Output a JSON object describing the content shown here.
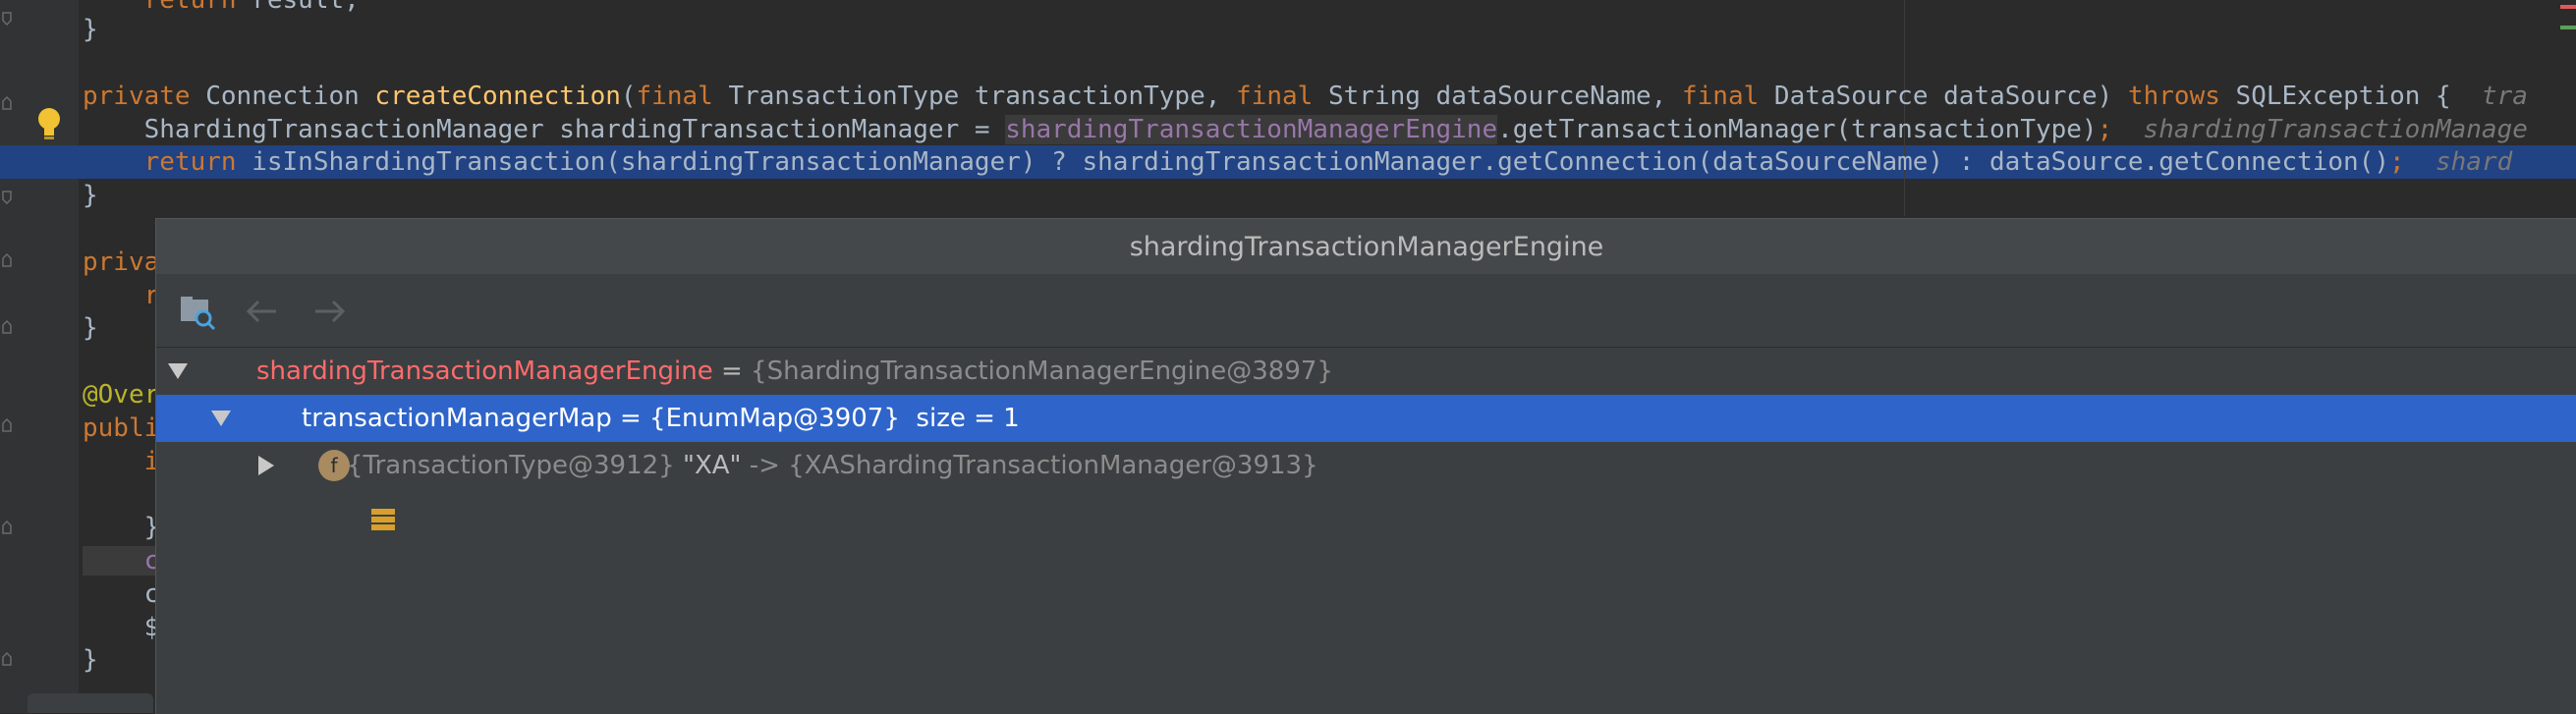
{
  "editor": {
    "lines": {
      "l0": {
        "indent": "    ",
        "kw": "return",
        "rest": " result;"
      },
      "l1": {
        "text": "}"
      },
      "l2": {
        "kw1": "private",
        "t1": " Connection ",
        "fn": "createConnection",
        "t2": "(",
        "kw2": "final",
        "t3": " TransactionType transactionType, ",
        "kw3": "final",
        "t4": " String dataSourceName, ",
        "kw4": "final",
        "t5": " DataSource dataSource) ",
        "kw5": "throws",
        "t6": " SQLException {  ",
        "hint": "tra"
      },
      "l3": {
        "t1": "    ShardingTransactionManager shardingTransactionManager = ",
        "fld": "shardingTransactionManagerEngine",
        "t2": ".getTransactionManager(transactionType)",
        "semi": ";",
        "hint": "  shardingTransactionManage"
      },
      "l4": {
        "indent": "    ",
        "kw": "return",
        "t1": " isInShardingTransaction(shardingTransactionManager) ? shardingTransactionManager.getConnection(dataSourceName) : dataSource.getConnection()",
        "semi": ";",
        "hint": "  shard"
      },
      "l5": {
        "text": "}"
      },
      "l6": {
        "text": "priva"
      },
      "l7": {
        "text": "    r"
      },
      "l8": {
        "text": "}"
      },
      "l9": {
        "text": "@Over"
      },
      "l10": {
        "text": "publi"
      },
      "l11": {
        "text": "    i"
      },
      "l12": {
        "text": "    }"
      },
      "l13": {
        "text": "    c"
      },
      "l14": {
        "text": "    c"
      },
      "l15": {
        "text": "    $"
      },
      "l16": {
        "text": "}"
      }
    }
  },
  "popup": {
    "title": "shardingTransactionManagerEngine",
    "toolbar": {
      "back_icon": "arrow-left-icon",
      "forward_icon": "arrow-right-icon",
      "folder_icon": "folder-search-icon"
    },
    "tree": {
      "root": {
        "name": "shardingTransactionManagerEngine",
        "eq": " = ",
        "value": "{ShardingTransactionManagerEngine@3897}"
      },
      "child": {
        "icon_letter": "f",
        "name": "transactionManagerMap",
        "eq": " = ",
        "value": "{EnumMap@3907}",
        "extra": "  size = 1"
      },
      "grandchild": {
        "key": "{TransactionType@3912}",
        "str": " \"XA\"",
        "arrow": " -> ",
        "value": "{XAShardingTransactionManager@3913}"
      }
    }
  },
  "colors": {
    "keyword": "#cc7832",
    "function": "#ffc66d",
    "field": "#9876aa",
    "selection": "#2f65ca",
    "editor_bg": "#2b2b2b",
    "popup_bg": "#3c3f41"
  }
}
